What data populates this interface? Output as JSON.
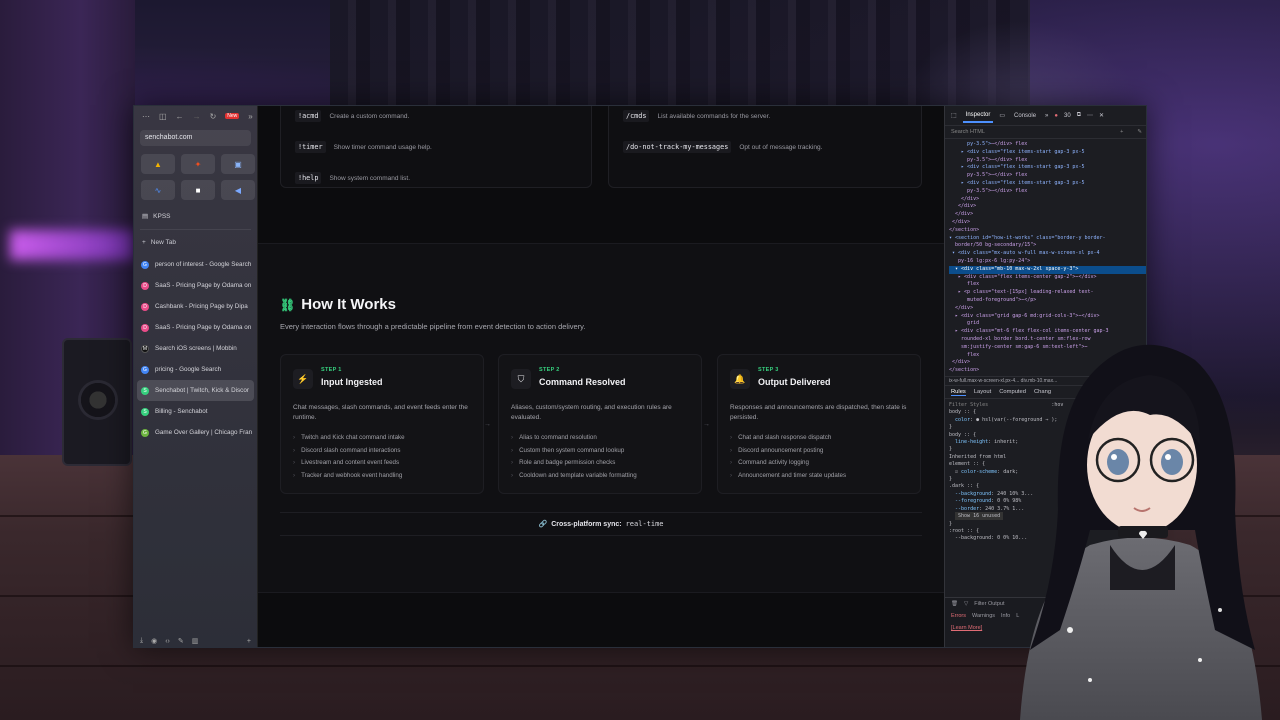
{
  "sidebar": {
    "url": "senchabot.com",
    "new_badge": "New",
    "pinned_folder": "KPSS",
    "new_tab_label": "New Tab",
    "tabs": [
      {
        "label": "person of interest - Google Search",
        "color": "#4285f4",
        "glyph": "G"
      },
      {
        "label": "SaaS - Pricing Page by Odama on",
        "color": "#ea4c89",
        "glyph": "D"
      },
      {
        "label": "Cashbank - Pricing Page by Dipa",
        "color": "#ea4c89",
        "glyph": "D"
      },
      {
        "label": "SaaS - Pricing Page by Odama on",
        "color": "#ea4c89",
        "glyph": "D"
      },
      {
        "label": "Search iOS screens | Mobbin",
        "color": "#222",
        "glyph": "M"
      },
      {
        "label": "pricing - Google Search",
        "color": "#4285f4",
        "glyph": "G"
      },
      {
        "label": "Senchabot | Twitch, Kick & Discor",
        "color": "#36d07e",
        "glyph": "S"
      },
      {
        "label": "Billing - Senchabot",
        "color": "#36d07e",
        "glyph": "S"
      },
      {
        "label": "Game Over Gallery | Chicago Fran",
        "color": "#6db33f",
        "glyph": "G"
      }
    ]
  },
  "commands": {
    "left": [
      {
        "code": "!acmd",
        "desc": "Create a custom command."
      },
      {
        "code": "!timer",
        "desc": "Show timer command usage help."
      },
      {
        "code": "!help",
        "desc": "Show system command list."
      }
    ],
    "right": [
      {
        "code": "/cmds",
        "desc": "List available commands for the server."
      },
      {
        "code": "/do-not-track-my-messages",
        "desc": "Opt out of message tracking."
      }
    ]
  },
  "how_it_works": {
    "title": "How It Works",
    "description": "Every interaction flows through a predictable pipeline from event detection to action delivery.",
    "steps": [
      {
        "tag": "STEP 1",
        "name": "Input Ingested",
        "icon": "⚡",
        "desc": "Chat messages, slash commands, and event feeds enter the runtime.",
        "items": [
          "Twitch and Kick chat command intake",
          "Discord slash command interactions",
          "Livestream and content event feeds",
          "Tracker and webhook event handling"
        ]
      },
      {
        "tag": "STEP 2",
        "name": "Command Resolved",
        "icon": "⛉",
        "desc": "Aliases, custom/system routing, and execution rules are evaluated.",
        "items": [
          "Alias to command resolution",
          "Custom then system command lookup",
          "Role and badge permission checks",
          "Cooldown and template variable formatting"
        ]
      },
      {
        "tag": "STEP 3",
        "name": "Output Delivered",
        "icon": "🔔",
        "desc": "Responses and announcements are dispatched, then state is persisted.",
        "items": [
          "Chat and slash response dispatch",
          "Discord announcement posting",
          "Command activity logging",
          "Announcement and timer state updates"
        ]
      }
    ],
    "sync_label": "Cross-platform sync:",
    "sync_value": "real-time"
  },
  "devtools": {
    "tabs": [
      "Inspector",
      "Console"
    ],
    "error_count": "30",
    "search_placeholder": "Search HTML",
    "breadcrumb": "ix-w-full.max-w-screen-xl.px-4...  div.mb-10.max...",
    "subtabs": [
      "Rules",
      "Layout",
      "Computed",
      "Chang"
    ],
    "filter_styles": "Filter Styles",
    "show_unused": "Show 16 unused",
    "filter_output": "Filter Output",
    "console_tabs": [
      "Errors",
      "Warnings",
      "Info",
      "L"
    ],
    "learn_more": "[Learn More]"
  }
}
